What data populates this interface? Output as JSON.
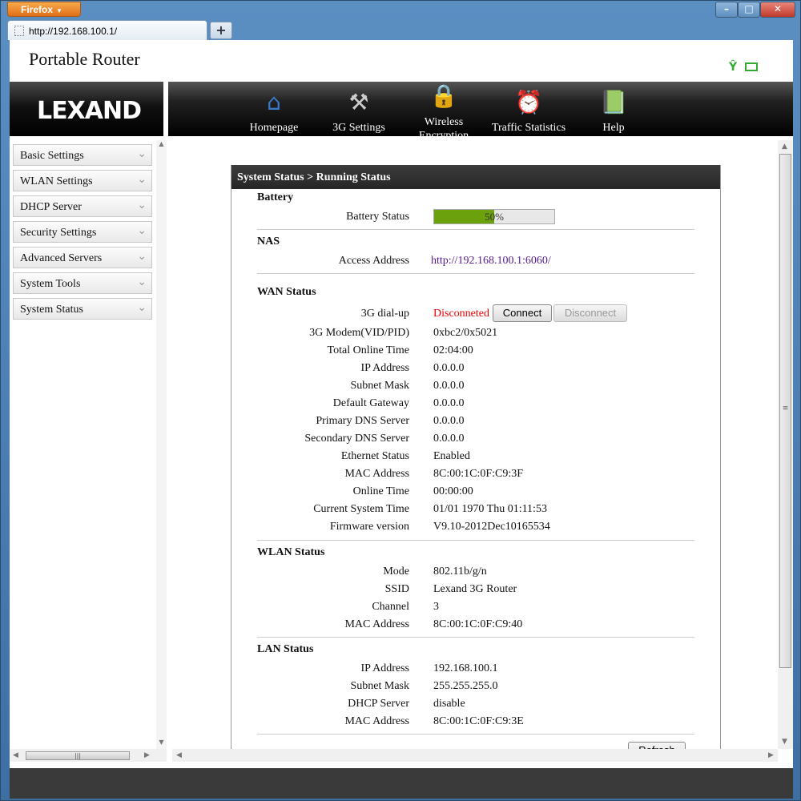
{
  "browser": {
    "menu_label": "Firefox",
    "tab_title": "http://192.168.100.1/",
    "new_tab": "+",
    "min": "–",
    "max": "□",
    "close": "✕"
  },
  "page": {
    "title": "Portable Router",
    "logo": "LEXAND"
  },
  "nav": [
    {
      "label": "Homepage",
      "icon": "home-icon"
    },
    {
      "label": "3G Settings",
      "icon": "tools-icon"
    },
    {
      "label": "Wireless Encryption",
      "icon": "wifi-lock-icon"
    },
    {
      "label": "Traffic Statistics",
      "icon": "alarm-clock-icon"
    },
    {
      "label": "Help",
      "icon": "book-icon"
    }
  ],
  "sidebar": [
    {
      "label": "Basic Settings"
    },
    {
      "label": "WLAN Settings"
    },
    {
      "label": "DHCP Server"
    },
    {
      "label": "Security Settings"
    },
    {
      "label": "Advanced Servers"
    },
    {
      "label": "System Tools"
    },
    {
      "label": "System Status"
    }
  ],
  "panel": {
    "title": "System Status > Running Status"
  },
  "battery": {
    "section": "Battery",
    "label": "Battery Status",
    "value": "50%",
    "level": 0.5,
    "color": "#6aa10d"
  },
  "nas": {
    "section": "NAS",
    "label": "Access Address",
    "value": "http://192.168.100.1:6060/"
  },
  "wan": {
    "section": "WAN Status",
    "dialup_label": "3G dial-up",
    "dialup_status": "Disconneted",
    "connect": "Connect",
    "disconnect": "Disconnect",
    "rows": [
      {
        "label": "3G Modem(VID/PID)",
        "value": "0xbc2/0x5021"
      },
      {
        "label": "Total Online Time",
        "value": "02:04:00"
      },
      {
        "label": "IP Address",
        "value": "0.0.0.0"
      },
      {
        "label": "Subnet Mask",
        "value": "0.0.0.0"
      },
      {
        "label": "Default Gateway",
        "value": "0.0.0.0"
      },
      {
        "label": "Primary DNS Server",
        "value": "0.0.0.0"
      },
      {
        "label": "Secondary DNS Server",
        "value": "0.0.0.0"
      },
      {
        "label": "Ethernet Status",
        "value": "Enabled"
      },
      {
        "label": "MAC Address",
        "value": "8C:00:1C:0F:C9:3F"
      },
      {
        "label": "Online Time",
        "value": "00:00:00"
      },
      {
        "label": "Current System Time",
        "value": "01/01 1970 Thu 01:11:53"
      },
      {
        "label": "Firmware version",
        "value": "V9.10-2012Dec10165534"
      }
    ]
  },
  "wlan": {
    "section": "WLAN Status",
    "rows": [
      {
        "label": "Mode",
        "value": "802.11b/g/n"
      },
      {
        "label": "SSID",
        "value": "Lexand 3G Router"
      },
      {
        "label": "Channel",
        "value": "3"
      },
      {
        "label": "MAC Address",
        "value": "8C:00:1C:0F:C9:40"
      }
    ]
  },
  "lan": {
    "section": "LAN Status",
    "rows": [
      {
        "label": "IP Address",
        "value": "192.168.100.1"
      },
      {
        "label": "Subnet Mask",
        "value": "255.255.255.0"
      },
      {
        "label": "DHCP Server",
        "value": "disable"
      },
      {
        "label": "MAC Address",
        "value": "8C:00:1C:0F:C9:3E"
      }
    ]
  },
  "refresh": "Refresh"
}
